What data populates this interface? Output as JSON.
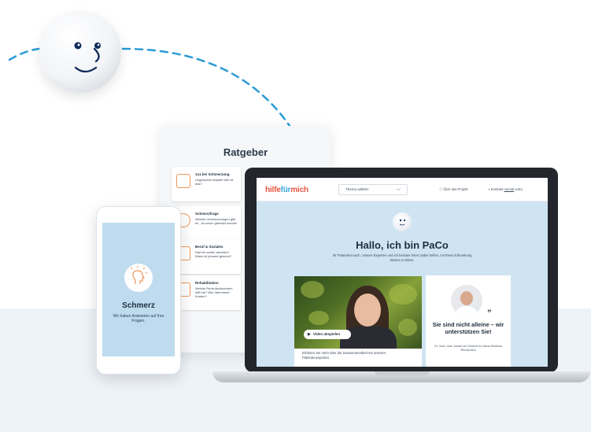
{
  "mascot": {
    "icon": "smiley-ball-icon"
  },
  "tablet": {
    "title": "Ratgeber",
    "cards": [
      {
        "title": "1x1 bei Schmerzung",
        "text": "Ungewohnt belastet Wie ist das?",
        "icon": "clipboard-icon"
      },
      {
        "title": "Schmerzfrage",
        "text": "Welche Untersuchungen gibt es - ist schon getestet worden",
        "icon": "clock-icon"
      },
      {
        "title": "Beruf & Soziales",
        "text": "Darf ich weiter arbeiten? Wann ist jemand gesund?",
        "icon": "briefcase-icon"
      },
      {
        "title": "Rehabilitation",
        "text": "Welche Reha Maßnahmen hilft mir? Wer übernimmt Kosten?",
        "icon": "bed-icon"
      }
    ]
  },
  "phone": {
    "title": "Schmerz",
    "subtitle": "Wir haben Antworten auf Ihre Fragen.",
    "icon": "head-idea-icon"
  },
  "laptop": {
    "logo": {
      "part1": "hilfe",
      "part2": "für",
      "part3": "mich"
    },
    "topic_select": "Thema wählen",
    "nav": {
      "about": "Über das Projekt",
      "contrast": "Kontrast",
      "contrast_normal": "normal",
      "contrast_extra": "extra"
    },
    "hero_title": "Hallo, ich bin PaCo",
    "hero_sub": "Ihr Patientencoach. Unsere Experten und ich beraten Ihnen dabei helfen, mit Ihrem Erkrankung besser zu leben.",
    "video_button": "Video abspielen",
    "video_caption": "Erfahren Sie mehr über die Zusammenarbeit mit unseren Patientenexperten.",
    "quote": "Sie sind nicht alleine – wir unterstützen Sie!",
    "quote_author": "Dr. med. Uwe Junker ist Chefarzt im Sana Klinikum Remscheid"
  },
  "colors": {
    "brand_red": "#e6553d",
    "brand_blue": "#39a9e0",
    "hero_bg": "#cfe4f2",
    "accent_orange": "#f0965a"
  }
}
